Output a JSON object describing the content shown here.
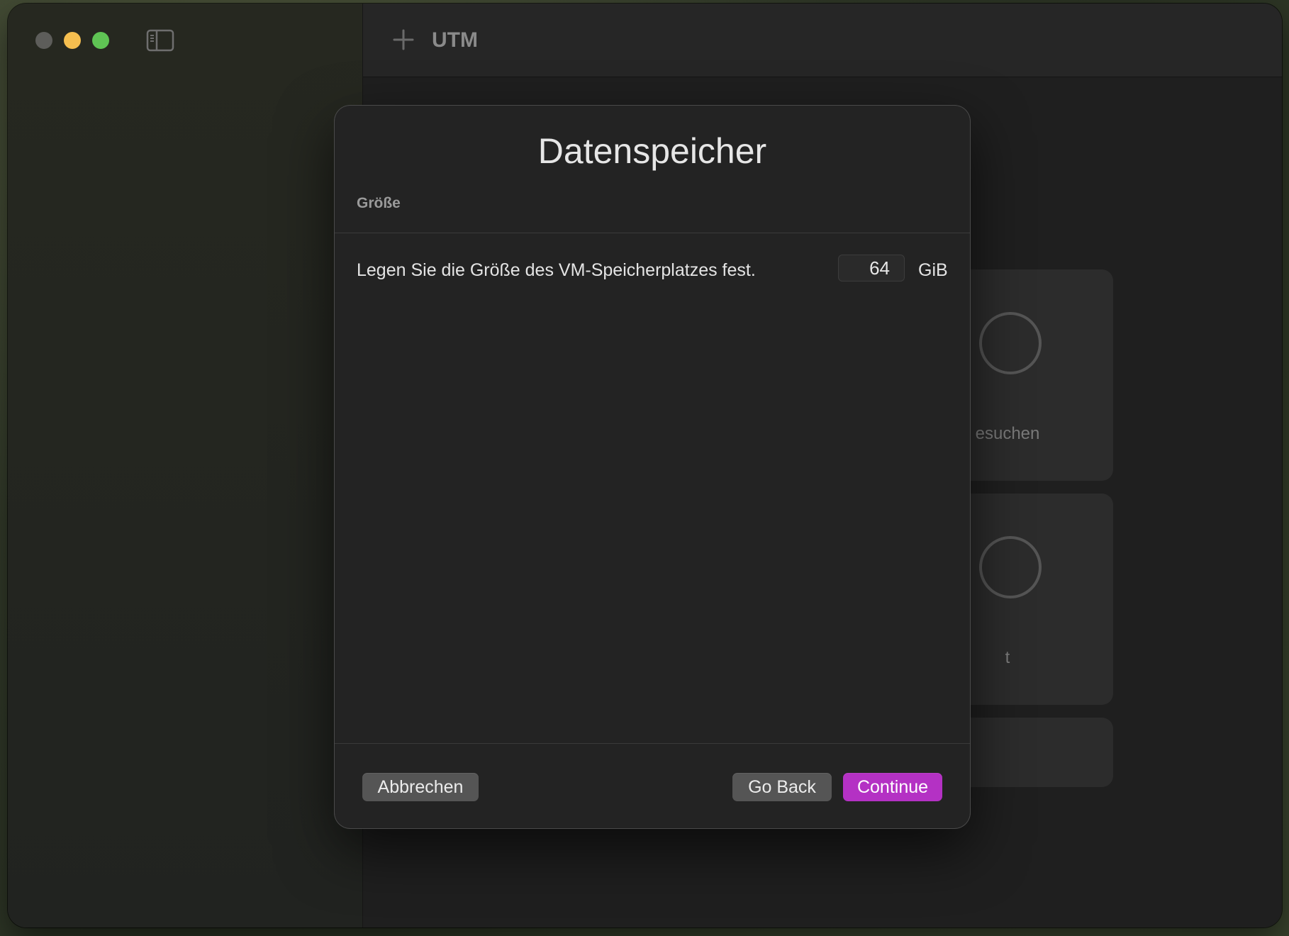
{
  "window": {
    "app_title": "UTM",
    "traffic_lights": [
      "close",
      "minimize",
      "maximize"
    ],
    "icons": {
      "sidebar_toggle": "sidebar-toggle-icon",
      "add": "plus-icon"
    }
  },
  "background_cards": [
    {
      "label": "esuchen"
    },
    {
      "label": "t"
    },
    {
      "label": ""
    }
  ],
  "dialog": {
    "title": "Datenspeicher",
    "section_header": "Größe",
    "size_field": {
      "label": "Legen Sie die Größe des VM-Speicherplatzes fest.",
      "value": "64",
      "unit": "GiB"
    },
    "buttons": {
      "cancel": "Abbrechen",
      "back": "Go Back",
      "continue": "Continue"
    }
  },
  "colors": {
    "accent": "#b431c4",
    "traffic_close": "#5d5d5a",
    "traffic_min": "#f5be4f",
    "traffic_max": "#5fc454"
  }
}
